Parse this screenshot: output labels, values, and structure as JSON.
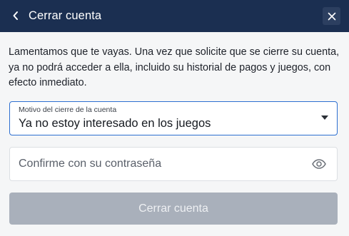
{
  "header": {
    "title": "Cerrar cuenta",
    "back_icon": "chevron-left-icon",
    "close_icon": "close-icon",
    "background": "#1b2f51"
  },
  "body": {
    "message": "Lamentamos que te vayas. Una vez que solicite que se cierre su cuenta, ya no podrá acceder a ella, incluido su historial de pagos y juegos, con efecto inmediato."
  },
  "reason_select": {
    "label": "Motivo del cierre de la cuenta",
    "selected": "Ya no estoy interesado en los juegos",
    "accent": "#2d6fd1"
  },
  "password": {
    "placeholder": "Confirme con su contraseña",
    "value": "",
    "toggle_icon": "eye-icon"
  },
  "submit": {
    "label": "Cerrar cuenta",
    "disabled_color": "#a9b0bb"
  }
}
